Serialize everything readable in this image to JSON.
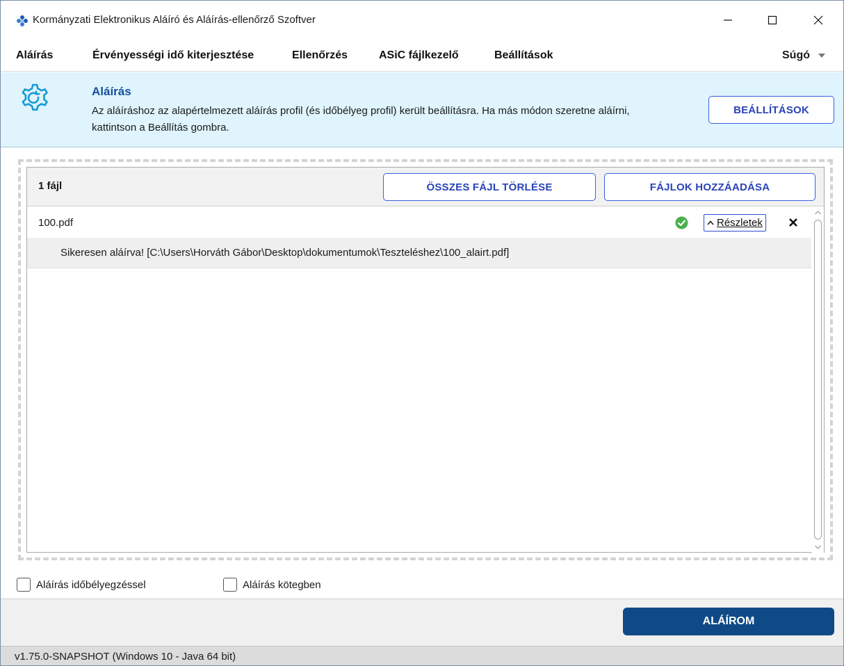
{
  "window": {
    "title": "Kormányzati Elektronikus Aláíró és Aláírás-ellenőrző Szoftver"
  },
  "menu": {
    "items": [
      {
        "label": "Aláírás"
      },
      {
        "label": "Érvényességi idő kiterjesztése"
      },
      {
        "label": "Ellenőrzés"
      },
      {
        "label": "ASiC fájlkezelő"
      },
      {
        "label": "Beállítások"
      }
    ],
    "help_label": "Súgó"
  },
  "banner": {
    "icon": "gear-icon",
    "title": "Aláírás",
    "text": "Az aláíráshoz az alapértelmezett aláírás profil (és időbélyeg profil) került beállításra. Ha más módon szeretne aláírni, kattintson a Beállítás gombra.",
    "button_label": "BEÁLLÍTÁSOK"
  },
  "files": {
    "count_label": "1 fájl",
    "delete_all_label": "ÖSSZES FÁJL TÖRLÉSE",
    "add_files_label": "FÁJLOK HOZZÁADÁSA",
    "items": [
      {
        "name": "100.pdf",
        "status_icon": "check-circle-icon",
        "details_label": "Részletek",
        "detail_text": "Sikeresen aláírva! [C:\\Users\\Horváth Gábor\\Desktop\\dokumentumok\\Teszteléshez\\100_alairt.pdf]"
      }
    ]
  },
  "options": {
    "timestamp_label": "Aláírás időbélyegzéssel",
    "timestamp_checked": false,
    "batch_label": "Aláírás kötegben",
    "batch_checked": false
  },
  "actions": {
    "sign_label": "ALÁÍROM"
  },
  "status": {
    "version": "v1.75.0-SNAPSHOT (Windows 10 - Java 64 bit)"
  },
  "colors": {
    "banner_bg": "#dff4fc",
    "accent_blue": "#2a43b8",
    "primary_button": "#0f4a86",
    "success_green": "#4caf50"
  }
}
